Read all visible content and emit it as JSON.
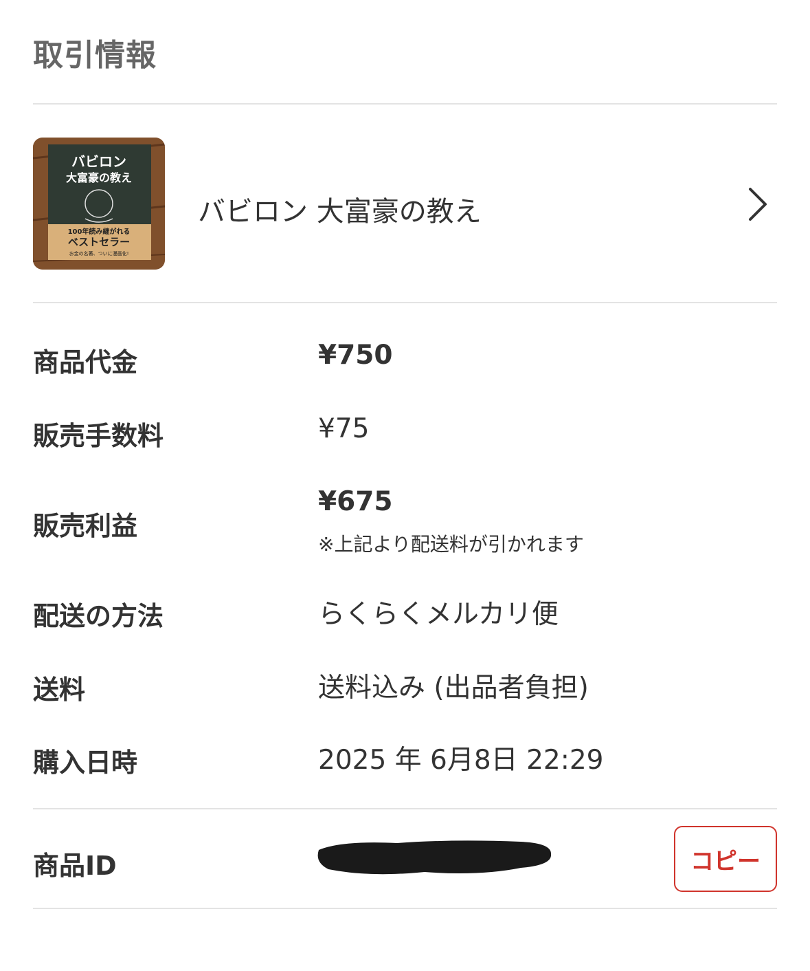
{
  "section": {
    "title": "取引情報"
  },
  "product": {
    "name": "バビロン 大富豪の教え",
    "thumbnail": {
      "cover_title_line1": "バビロン",
      "cover_title_line2": "大富豪の教え",
      "cover_band_line1": "100年読み継がれる",
      "cover_band_line2": "ベストセラー",
      "cover_band_line3": "お金の名著、ついに漫画化!"
    },
    "chevron_icon": "chevron-right-icon"
  },
  "info": {
    "price": {
      "label": "商品代金",
      "value": "¥750"
    },
    "fee": {
      "label": "販売手数料",
      "value": "¥75"
    },
    "profit": {
      "label": "販売利益",
      "value": "¥675",
      "note": "※上記より配送料が引かれます"
    },
    "shipping_method": {
      "label": "配送の方法",
      "value": "らくらくメルカリ便"
    },
    "shipping_fee": {
      "label": "送料",
      "value": "送料込み (出品者負担)"
    },
    "purchase_date": {
      "label": "購入日時",
      "value": "2025 年 6月8日 22:29"
    }
  },
  "item_id": {
    "label": "商品ID",
    "copy_label": "コピー"
  },
  "colors": {
    "accent": "#d0342c",
    "label_gray": "#666666",
    "text": "#333333",
    "divider": "#e3e3e3"
  }
}
